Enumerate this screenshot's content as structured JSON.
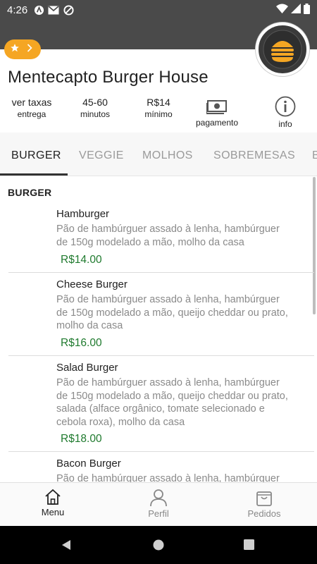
{
  "status": {
    "time": "4:26",
    "icons": [
      "app-a-icon",
      "gmail-icon",
      "blocked-icon"
    ],
    "right_icons": [
      "wifi-icon",
      "signal-icon",
      "battery-icon"
    ]
  },
  "restaurant": {
    "name": "Mentecapto Burger House",
    "accent": "#f5a623"
  },
  "info": {
    "fees": {
      "top": "ver taxas",
      "bottom": "entrega"
    },
    "time": {
      "top": "45-60",
      "bottom": "minutos"
    },
    "minimum": {
      "top": "R$14",
      "bottom": "mínimo"
    },
    "payment": {
      "label": "pagamento"
    },
    "info": {
      "label": "info"
    }
  },
  "tabs": [
    {
      "label": "BURGER",
      "active": true
    },
    {
      "label": "VEGGIE",
      "active": false
    },
    {
      "label": "MOLHOS",
      "active": false
    },
    {
      "label": "SOBREMESAS",
      "active": false
    },
    {
      "label": "B",
      "active": false
    }
  ],
  "section": {
    "title": "BURGER"
  },
  "items": [
    {
      "name": "Hamburger",
      "desc": [
        "Pão de hambúrguer assado à lenha, hambúrguer",
        "de 150g modelado a mão, molho da casa"
      ],
      "price": "R$14.00"
    },
    {
      "name": "Cheese Burger",
      "desc": [
        "Pão de hambúrguer assado à lenha, hambúrguer",
        "de 150g modelado a mão, queijo cheddar ou prato,",
        "molho da casa"
      ],
      "price": "R$16.00"
    },
    {
      "name": "Salad Burger",
      "desc": [
        "Pão de hambúrguer assado à lenha, hambúrguer",
        "de 150g modelado a mão, queijo cheddar ou prato,",
        "salada (alface orgânico, tomate selecionado e",
        "cebola roxa), molho da casa"
      ],
      "price": "R$18.00"
    },
    {
      "name": "Bacon Burger",
      "desc": [
        "Pão de hambúrguer assado à lenha, hambúrguer"
      ],
      "price": ""
    }
  ],
  "bottom_nav": [
    {
      "label": "Menu",
      "icon": "home-icon",
      "active": true
    },
    {
      "label": "Perfil",
      "icon": "person-icon",
      "active": false
    },
    {
      "label": "Pedidos",
      "icon": "shopping-bag-icon",
      "active": false
    }
  ]
}
